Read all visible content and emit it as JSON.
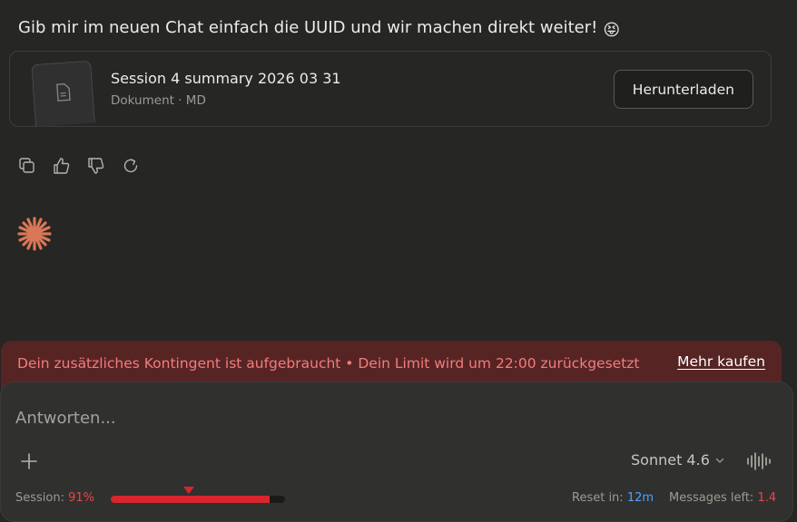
{
  "message": {
    "text": "Gib mir im neuen Chat einfach die UUID und wir machen direkt weiter!",
    "emoji": "😝"
  },
  "attachment": {
    "title": "Session 4 summary 2026 03 31",
    "meta": "Dokument · MD",
    "download_label": "Herunterladen",
    "icon": "document-icon"
  },
  "actions": {
    "icons": [
      "copy-icon",
      "thumbs-up-icon",
      "thumbs-down-icon",
      "retry-icon"
    ]
  },
  "banner": {
    "text": "Dein zusätzliches Kontingent ist aufgebraucht • Dein Limit wird um 22:00 zurückgesetzt",
    "link_label": "Mehr kaufen"
  },
  "composer": {
    "placeholder": "Antworten...",
    "model_label": "Sonnet 4.6"
  },
  "usage": {
    "session_label": "Session:",
    "session_value": "91%",
    "session_fraction": 0.91,
    "marker_fraction": 0.45,
    "reset_label": "Reset in:",
    "reset_value": "12m",
    "messages_label": "Messages left:",
    "messages_value": "1.4"
  },
  "colors": {
    "background": "#262624",
    "banner_bg": "#572424",
    "banner_text": "#f27d7d",
    "accent_orange": "#d97757",
    "usage_red": "#d8262e",
    "usage_blue": "#4da3ff"
  }
}
